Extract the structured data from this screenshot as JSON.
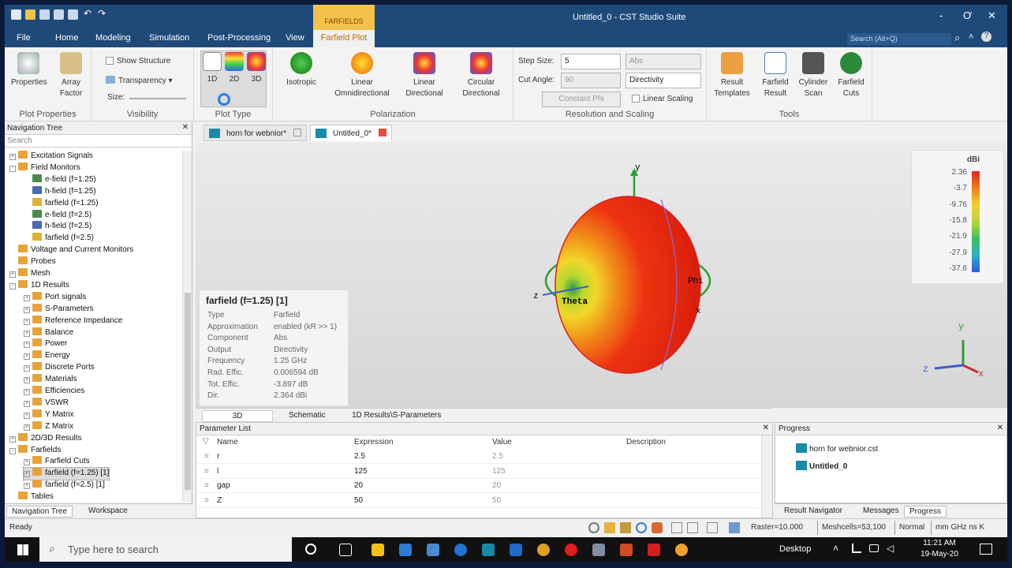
{
  "window": {
    "title": "Untitled_0 - CST Studio Suite",
    "context_tab": "FARFIELDS",
    "minimize": "-",
    "restore": "Ơ",
    "close": "✕"
  },
  "menu": {
    "tabs": [
      "File",
      "Home",
      "Modeling",
      "Simulation",
      "Post-Processing",
      "View"
    ],
    "active_tab": "Farfield Plot",
    "search_placeholder": "Search (Alt+Q)"
  },
  "ribbon": {
    "plot_properties": {
      "label": "Plot Properties",
      "properties": "Properties",
      "array_factor": "Array Factor"
    },
    "visibility": {
      "label": "Visibility",
      "show_structure": "Show Structure",
      "transparency": "Transparency",
      "size": "Size:"
    },
    "plot_type": {
      "label": "Plot Type",
      "d1": "1D",
      "d2": "2D",
      "d3": "3D"
    },
    "polarization": {
      "label": "Polarization",
      "isotropic": "Isotropic",
      "linear_omni": "Linear Omnidirectional",
      "linear_dir": "Linear Directional",
      "circular_dir": "Circular Directional"
    },
    "resolution": {
      "label": "Resolution and Scaling",
      "step_size_label": "Step Size:",
      "step_size": "5",
      "cut_angle_label": "Cut Angle:",
      "cut_angle": "90",
      "constant": "Constant Phi",
      "abs": "Abs",
      "directivity": "Directivity",
      "linear_scaling": "Linear Scaling"
    },
    "tools": {
      "label": "Tools",
      "result_templates": "Result Templates",
      "farfield_result": "Farfield Result",
      "cylinder_scan": "Cylinder Scan",
      "farfield_cuts": "Farfield Cuts"
    }
  },
  "nav": {
    "title": "Navigation Tree",
    "close": "✕",
    "search_placeholder": "Search",
    "items": [
      {
        "label": "Excitation Signals",
        "indent": 0,
        "icon": "folder",
        "exp": "+"
      },
      {
        "label": "Field Monitors",
        "indent": 0,
        "icon": "folder",
        "exp": "-"
      },
      {
        "label": "e-field (f=1.25)",
        "indent": 1,
        "icon": "efield"
      },
      {
        "label": "h-field (f=1.25)",
        "indent": 1,
        "icon": "hfield"
      },
      {
        "label": "farfield (f=1.25)",
        "indent": 1,
        "icon": "farfield"
      },
      {
        "label": "e-field (f=2.5)",
        "indent": 1,
        "icon": "efield"
      },
      {
        "label": "h-field (f=2.5)",
        "indent": 1,
        "icon": "hfield"
      },
      {
        "label": "farfield (f=2.5)",
        "indent": 1,
        "icon": "farfield"
      },
      {
        "label": "Voltage and Current Monitors",
        "indent": 0,
        "icon": "folder"
      },
      {
        "label": "Probes",
        "indent": 0,
        "icon": "folder"
      },
      {
        "label": "Mesh",
        "indent": 0,
        "icon": "folder",
        "exp": "+"
      },
      {
        "label": "1D Results",
        "indent": 0,
        "icon": "folder",
        "exp": "-"
      },
      {
        "label": "Port signals",
        "indent": 1,
        "icon": "folder",
        "exp": "+"
      },
      {
        "label": "S-Parameters",
        "indent": 1,
        "icon": "folder",
        "exp": "+"
      },
      {
        "label": "Reference Impedance",
        "indent": 1,
        "icon": "folder",
        "exp": "+"
      },
      {
        "label": "Balance",
        "indent": 1,
        "icon": "folder",
        "exp": "+"
      },
      {
        "label": "Power",
        "indent": 1,
        "icon": "folder",
        "exp": "+"
      },
      {
        "label": "Energy",
        "indent": 1,
        "icon": "folder",
        "exp": "+"
      },
      {
        "label": "Discrete Ports",
        "indent": 1,
        "icon": "folder",
        "exp": "+"
      },
      {
        "label": "Materials",
        "indent": 1,
        "icon": "folder",
        "exp": "+"
      },
      {
        "label": "Efficiencies",
        "indent": 1,
        "icon": "folder",
        "exp": "+"
      },
      {
        "label": "VSWR",
        "indent": 1,
        "icon": "folder",
        "exp": "+"
      },
      {
        "label": "Y Matrix",
        "indent": 1,
        "icon": "folder",
        "exp": "+"
      },
      {
        "label": "Z Matrix",
        "indent": 1,
        "icon": "folder",
        "exp": "+"
      },
      {
        "label": "2D/3D Results",
        "indent": 0,
        "icon": "folder",
        "exp": "+"
      },
      {
        "label": "Farfields",
        "indent": 0,
        "icon": "folder",
        "exp": "-"
      },
      {
        "label": "Farfield Cuts",
        "indent": 1,
        "icon": "folder",
        "exp": "+"
      },
      {
        "label": "farfield (f=1.25) [1]",
        "indent": 1,
        "icon": "folder",
        "exp": "+",
        "selected": true
      },
      {
        "label": "farfield (f=2.5) [1]",
        "indent": 1,
        "icon": "folder",
        "exp": "+"
      },
      {
        "label": "Tables",
        "indent": 0,
        "icon": "folder"
      }
    ],
    "tabs": [
      "Navigation Tree",
      "Workspace"
    ]
  },
  "doc_tabs": [
    "horn for webnior*",
    "Untitled_0*"
  ],
  "viewport": {
    "info_title": "farfield (f=1.25) [1]",
    "info_rows": [
      {
        "k": "Type",
        "v": "Farfield"
      },
      {
        "k": "Approximation",
        "v": "enabled (kR >> 1)"
      },
      {
        "k": "Component",
        "v": "Abs"
      },
      {
        "k": "Output",
        "v": "Directivity"
      },
      {
        "k": "Frequency",
        "v": "1.25 GHz"
      },
      {
        "k": "Rad. Effic.",
        "v": "0.006594 dB"
      },
      {
        "k": "Tot. Effic.",
        "v": "-3.897 dB"
      },
      {
        "k": "Dir.",
        "v": "2.364 dBi"
      }
    ],
    "legend_unit": "dBi",
    "legend_values": [
      "2.36",
      "-3.7",
      "-9.76",
      "-15.8",
      "-21.9",
      "-27.9",
      "-37.6"
    ],
    "axis_y": "y",
    "axis_z": "z",
    "axis_x": "x",
    "theta": "Theta",
    "phi": "Phi",
    "mini_y": "y",
    "mini_z": "z",
    "mini_x": "x"
  },
  "view_tabs": [
    "3D",
    "Schematic",
    "1D Results\\S-Parameters"
  ],
  "param_list": {
    "title": "Parameter List",
    "close": "✕",
    "headers": [
      "Name",
      "Expression",
      "Value",
      "Description"
    ],
    "rows": [
      {
        "name": "r",
        "expr": "2.5",
        "value": "2.5",
        "desc": ""
      },
      {
        "name": "l",
        "expr": "125",
        "value": "125",
        "desc": ""
      },
      {
        "name": "gap",
        "expr": "20",
        "value": "20",
        "desc": ""
      },
      {
        "name": "Z",
        "expr": "50",
        "value": "50",
        "desc": ""
      }
    ]
  },
  "progress": {
    "title": "Progress",
    "close": "✕",
    "items": [
      "horn for webnior.cst",
      "Untitled_0"
    ],
    "tabs": [
      "Result Navigator",
      "Messages",
      "Progress"
    ]
  },
  "status": {
    "ready": "Ready",
    "raster": "Raster=10.000",
    "meshcells": "Meshcells=53,100",
    "normal": "Normal",
    "units": "mm GHz ns K"
  },
  "taskbar": {
    "search_placeholder": "Type here to search",
    "desktop": "Desktop",
    "time": "11:21 AM",
    "date": "19-May-20"
  },
  "colors": {
    "titlebar": "#1e4a7a",
    "accent": "#f3c14c",
    "pattern": "#ee3311"
  }
}
